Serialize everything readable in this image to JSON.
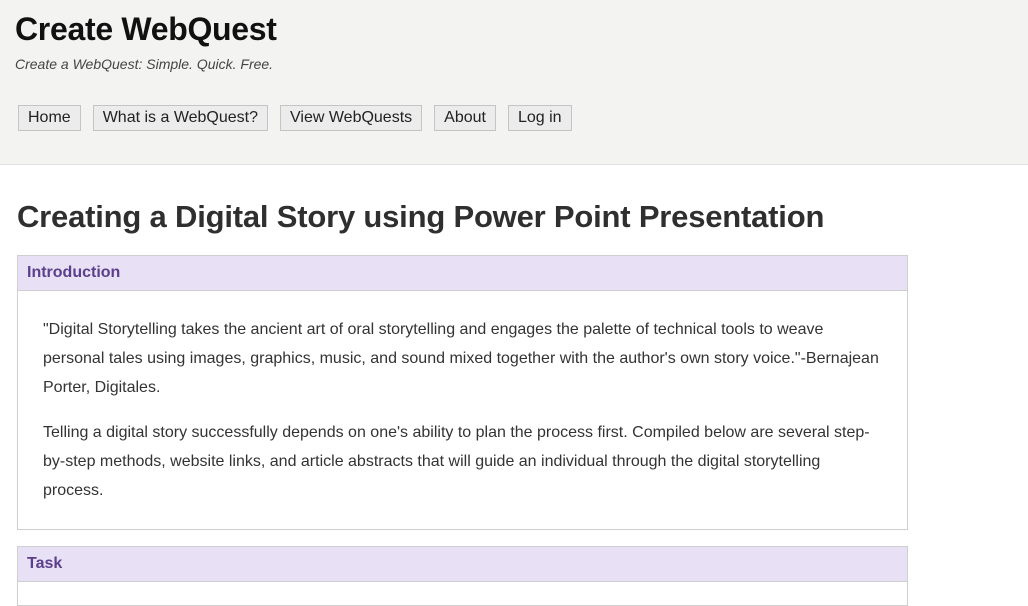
{
  "site": {
    "title": "Create WebQuest",
    "tagline": "Create a WebQuest: Simple. Quick. Free."
  },
  "nav": {
    "items": [
      {
        "label": "Home"
      },
      {
        "label": "What is a WebQuest?"
      },
      {
        "label": "View WebQuests"
      },
      {
        "label": "About"
      },
      {
        "label": "Log in"
      }
    ]
  },
  "page": {
    "title": "Creating a Digital Story using Power Point Presentation"
  },
  "sections": {
    "introduction": {
      "heading": "Introduction",
      "paragraphs": [
        "\"Digital Storytelling takes the ancient art of oral storytelling and engages the palette of technical tools to weave personal tales using images, graphics, music, and sound mixed together with the author's own story voice.\"-Bernajean Porter, Digitales.",
        "Telling a digital story successfully depends on one's ability to plan the process first. Compiled below are several step-by-step methods, website links, and article abstracts that will guide an individual through the digital storytelling process."
      ]
    },
    "task": {
      "heading": "Task"
    }
  },
  "colors": {
    "header_bg": "#f3f3f2",
    "section_header_bg": "#e8e1f5",
    "section_header_text": "#5c3f8c"
  }
}
